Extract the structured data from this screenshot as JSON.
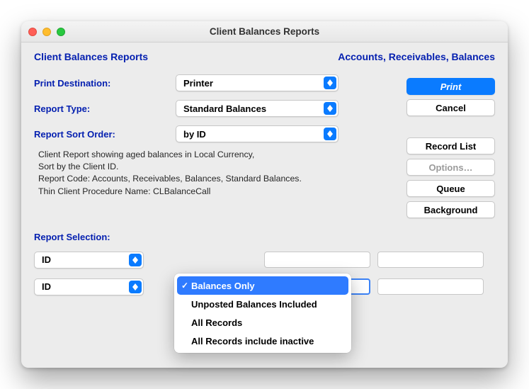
{
  "window": {
    "title": "Client Balances Reports"
  },
  "header": {
    "left": "Client Balances Reports",
    "right": "Accounts, Receivables, Balances"
  },
  "labels": {
    "dest": "Print Destination:",
    "type": "Report Type:",
    "sort": "Report Sort Order:",
    "selection": "Report Selection:"
  },
  "selects": {
    "dest": "Printer",
    "type": "Standard Balances",
    "sort": "by ID",
    "filter1": "ID",
    "filter2": "ID"
  },
  "description": {
    "l1": "Client Report showing aged balances in Local Currency,",
    "l2": "Sort by the Client ID.",
    "l3": "Report Code: Accounts, Receivables, Balances, Standard Balances.",
    "l4": "Thin Client Procedure Name: CLBalanceCall"
  },
  "buttons": {
    "print": "Print",
    "cancel": "Cancel",
    "recordlist": "Record List",
    "options": "Options…",
    "queue": "Queue",
    "background": "Background"
  },
  "popup": {
    "items": [
      "Balances Only",
      "Unposted Balances Included",
      "All Records",
      "All Records include inactive"
    ],
    "selected_index": 0
  }
}
